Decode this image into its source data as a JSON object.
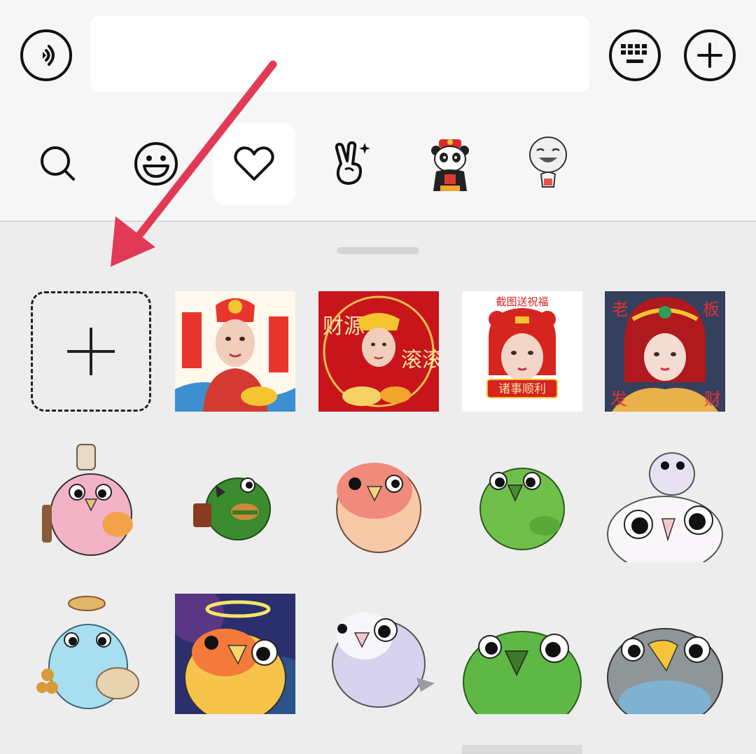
{
  "input_bar": {
    "voice_icon": "voice-waves-icon",
    "text_value": "",
    "keyboard_icon": "keyboard-icon",
    "plus_icon": "plus-icon"
  },
  "tabs": [
    {
      "icon": "search-icon",
      "active": false
    },
    {
      "icon": "smiley-face-icon",
      "active": false
    },
    {
      "icon": "heart-icon",
      "active": true
    },
    {
      "icon": "victory-hand-sparkle-icon",
      "active": false
    },
    {
      "icon": "panda-sticker-pack-icon",
      "active": false
    },
    {
      "icon": "laughing-face-sticker-pack-icon",
      "active": false
    }
  ],
  "stickers": {
    "add_icon": "plus-icon",
    "row1": [
      {
        "kind": "god-of-wealth-photo",
        "text": "",
        "accent": "#d8312b"
      },
      {
        "kind": "god-of-wealth-red-circle",
        "text_left": "财源",
        "text_right": "滚滚",
        "accent": "#c8151b"
      },
      {
        "kind": "tiger-hat-banner",
        "header": "截图送祝福",
        "banner": "诸事顺利",
        "accent": "#d6241f"
      },
      {
        "kind": "opera-crown",
        "corners": [
          "老",
          "板",
          "发",
          "财"
        ],
        "accent": "#9a1b1b"
      }
    ],
    "row2": [
      {
        "kind": "pink-parrot-bubbletea",
        "body": "#f3b3c7"
      },
      {
        "kind": "green-parrot-burger",
        "body": "#3a8c2e"
      },
      {
        "kind": "peach-lovebird",
        "body": "#f08a7b"
      },
      {
        "kind": "green-lovebird",
        "body": "#6fbf4a"
      },
      {
        "kind": "white-lovebirds-stacked",
        "body": "#f4f1f4"
      }
    ],
    "row3": [
      {
        "kind": "blue-parrot-eggtart",
        "body": "#a8dff0"
      },
      {
        "kind": "halo-lovebird-space",
        "body": "#f7c44b"
      },
      {
        "kind": "lilac-lovebird",
        "body": "#d7d3ef"
      },
      {
        "kind": "green-lovebird-closeup",
        "body": "#5fb845"
      },
      {
        "kind": "grey-lovebird",
        "body": "#8f9698"
      }
    ]
  },
  "annotation": {
    "arrow_color": "#e23a56",
    "points_to": "add-sticker-button"
  }
}
